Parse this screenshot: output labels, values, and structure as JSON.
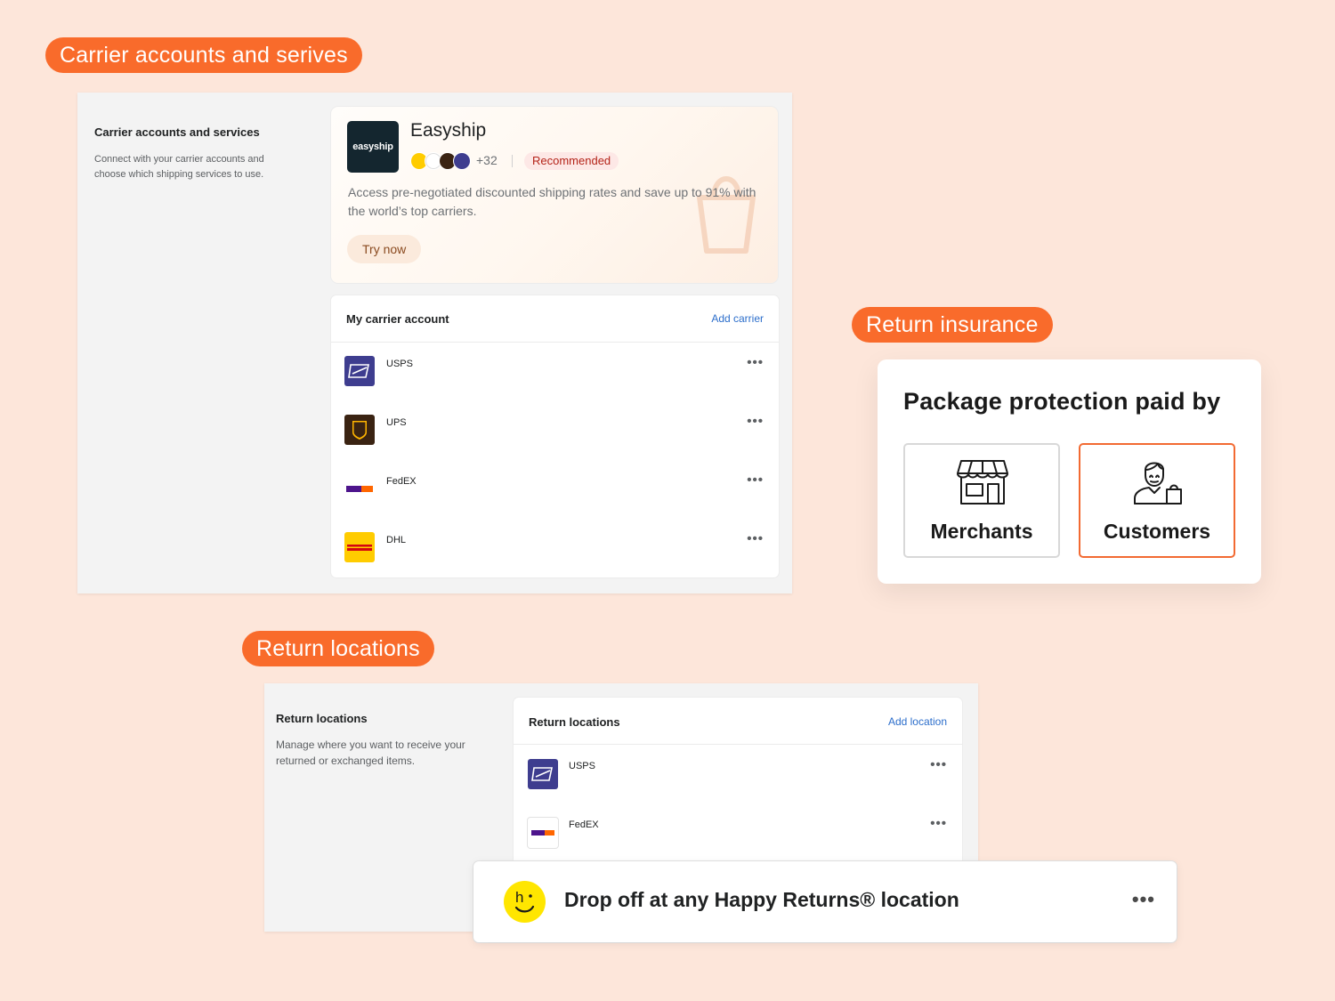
{
  "sections": {
    "carrier_pill": "Carrier accounts and serives",
    "insurance_pill": "Return insurance",
    "locations_pill": "Return locations"
  },
  "carrier_panel": {
    "title": "Carrier accounts and services",
    "description": "Connect with your carrier accounts and choose which shipping services to use.",
    "easyship": {
      "logo_text": "easyship",
      "title": "Easyship",
      "more_count": "+32",
      "badge": "Recommended",
      "description": "Access pre-negotiated discounted shipping rates and save up to 91% with the world’s top carriers.",
      "cta": "Try now",
      "carrier_icons": [
        "dhl-icon",
        "fedex-icon",
        "ups-icon",
        "usps-icon"
      ]
    },
    "list": {
      "title": "My carrier account",
      "add_link": "Add carrier",
      "items": [
        {
          "name": "USPS",
          "icon": "usps-logo-icon"
        },
        {
          "name": "UPS",
          "icon": "ups-logo-icon"
        },
        {
          "name": "FedEX",
          "icon": "fedex-logo-icon"
        },
        {
          "name": "DHL",
          "icon": "dhl-logo-icon"
        }
      ],
      "more": "•••"
    }
  },
  "insurance": {
    "title": "Package protection paid by",
    "options": [
      {
        "label": "Merchants",
        "icon": "storefront-icon",
        "selected": false
      },
      {
        "label": "Customers",
        "icon": "customer-with-bag-icon",
        "selected": true
      }
    ],
    "accent_color": "#f26a32"
  },
  "return_panel": {
    "title": "Return locations",
    "description": "Manage where you want to receive your returned or exchanged items.",
    "list": {
      "title": "Return locations",
      "add_link": "Add location",
      "items": [
        {
          "name": "USPS",
          "icon": "usps-logo-icon"
        },
        {
          "name": "FedEX",
          "icon": "fedex-logo-icon"
        }
      ],
      "more": "•••"
    },
    "happy_returns": {
      "text": "Drop off at any Happy Returns® location",
      "logo_text": "h",
      "icon": "happy-returns-logo-icon",
      "more": "•••"
    }
  },
  "colors": {
    "background": "#fde6da",
    "pill": "#f96b2b",
    "link": "#2c6ecb",
    "badge_text": "#b42318"
  }
}
